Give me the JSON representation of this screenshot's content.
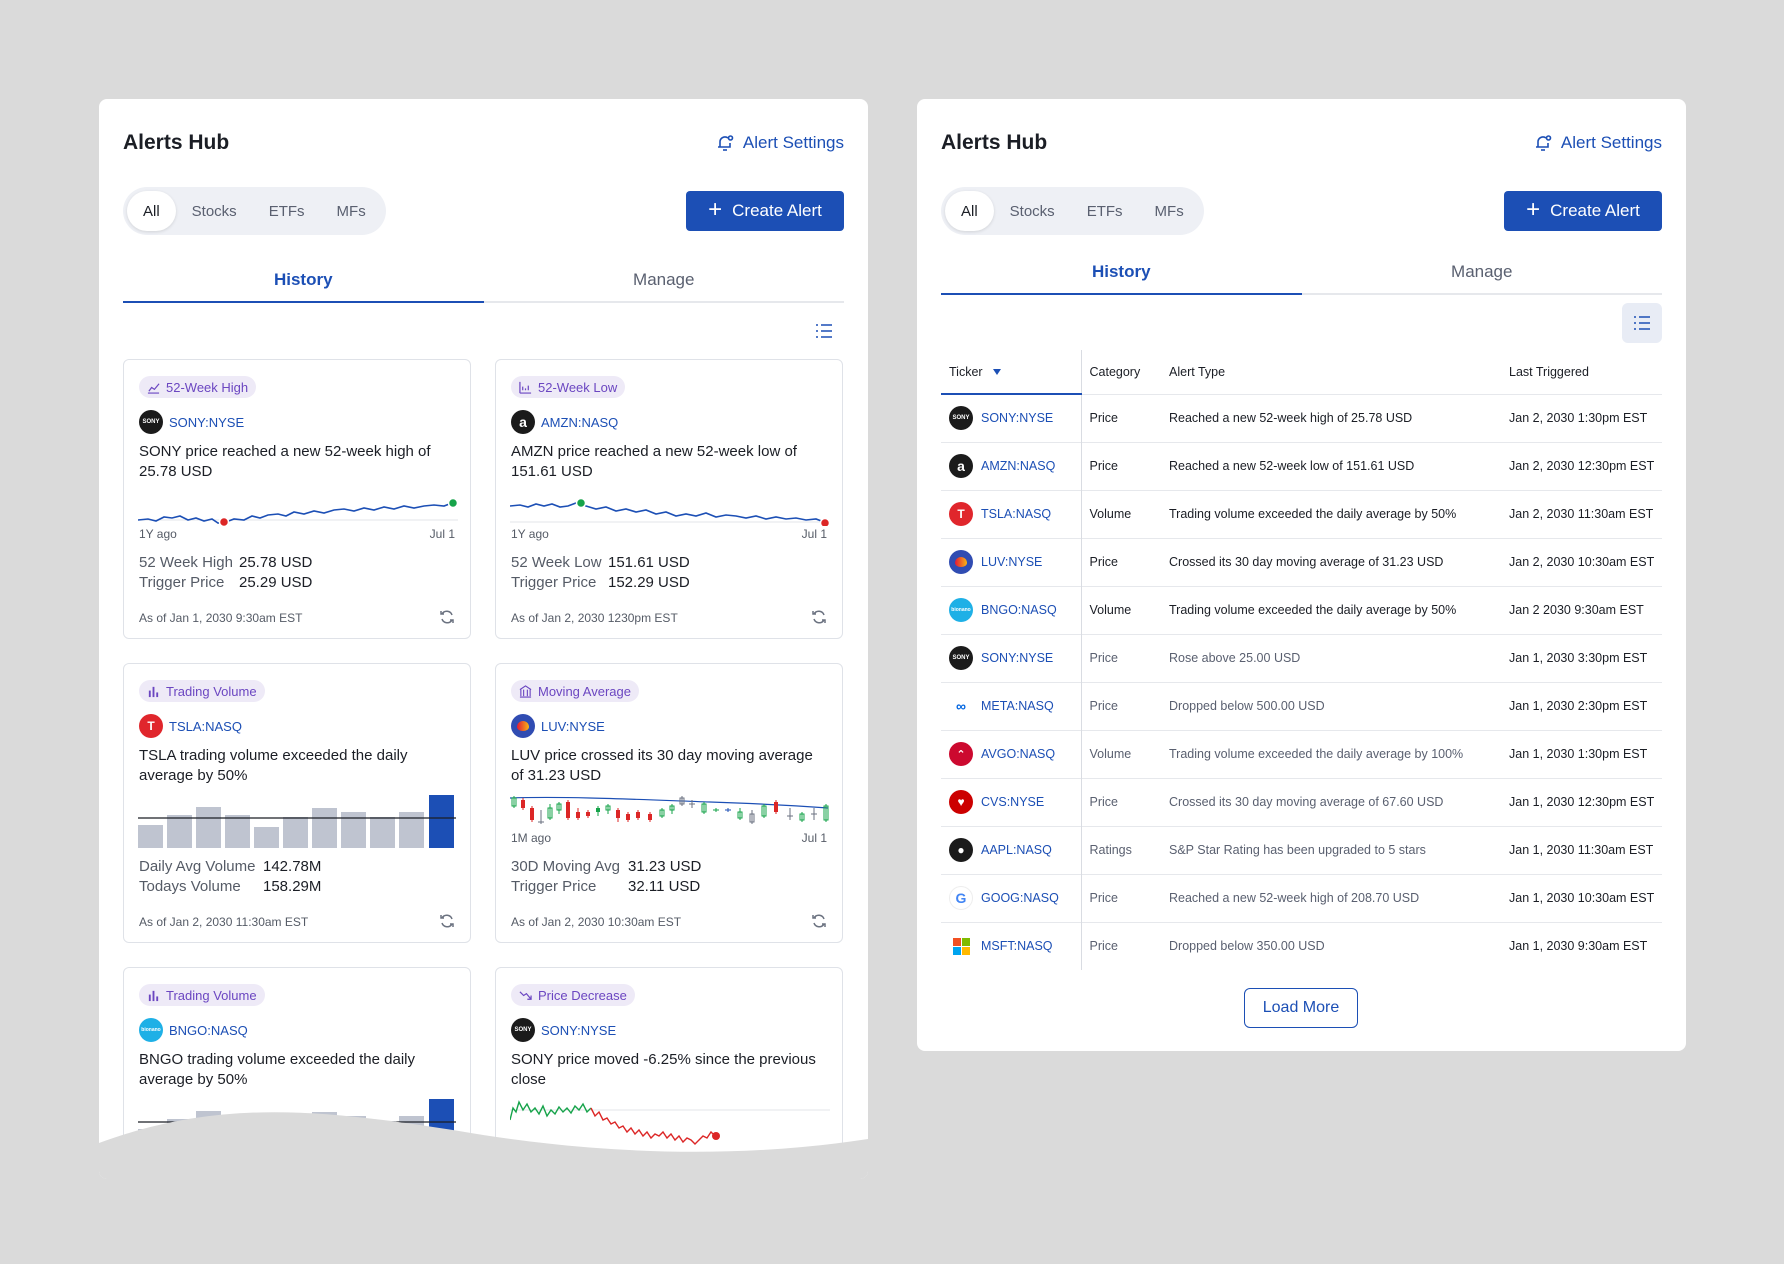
{
  "app": {
    "title": "Alerts Hub",
    "settings_label": "Alert Settings",
    "create_label": "Create Alert",
    "filters": [
      "All",
      "Stocks",
      "ETFs",
      "MFs"
    ],
    "tabs": [
      "History",
      "Manage"
    ],
    "colors": {
      "primary": "#1c4fb5",
      "badge_bg": "#eeeaf7",
      "badge_text": "#6b46c1",
      "up": "#16a34a",
      "down": "#dc2626"
    }
  },
  "cards": [
    {
      "badge": "52-Week High",
      "badge_icon": "chart-up-icon",
      "ticker": "SONY:NYSE",
      "logo": "sony-logo",
      "message": "SONY price reached a new 52-week high of 25.78 USD",
      "axis_left": "1Y ago",
      "axis_right": "Jul 1",
      "stats": [
        {
          "k": "52 Week High",
          "v": "25.78 USD"
        },
        {
          "k": "Trigger Price",
          "v": "25.29 USD"
        }
      ],
      "as_of": "As of Jan 1, 2030 9:30am EST"
    },
    {
      "badge": "52-Week Low",
      "badge_icon": "chart-down-icon",
      "ticker": "AMZN:NASQ",
      "logo": "amazon-logo",
      "message": "AMZN price reached a new 52-week low of 151.61 USD",
      "axis_left": "1Y ago",
      "axis_right": "Jul 1",
      "stats": [
        {
          "k": "52 Week Low",
          "v": "151.61 USD"
        },
        {
          "k": "Trigger Price",
          "v": "152.29 USD"
        }
      ],
      "as_of": "As of Jan 2, 2030 1230pm EST"
    },
    {
      "badge": "Trading Volume",
      "badge_icon": "bar-chart-icon",
      "ticker": "TSLA:NASQ",
      "logo": "tesla-logo",
      "message": "TSLA trading volume exceeded the daily average by 50%",
      "axis_left": "",
      "axis_right": "",
      "stats": [
        {
          "k": "Daily Avg Volume",
          "v": "142.78M"
        },
        {
          "k": "Todays Volume",
          "v": "158.29M"
        }
      ],
      "as_of": "As of Jan 2, 2030 11:30am EST"
    },
    {
      "badge": "Moving Average",
      "badge_icon": "bank-icon",
      "ticker": "LUV:NYSE",
      "logo": "southwest-logo",
      "message": "LUV price crossed its 30 day moving average of 31.23 USD",
      "axis_left": "1M ago",
      "axis_right": "Jul 1",
      "stats": [
        {
          "k": "30D Moving Avg",
          "v": "31.23 USD"
        },
        {
          "k": "Trigger Price",
          "v": "32.11 USD"
        }
      ],
      "as_of": "As of Jan 2, 2030 10:30am EST"
    },
    {
      "badge": "Trading Volume",
      "badge_icon": "bar-chart-icon",
      "ticker": "BNGO:NASQ",
      "logo": "bionano-logo",
      "message": "BNGO trading volume exceeded the daily average by 50%"
    },
    {
      "badge": "Price Decrease",
      "badge_icon": "trend-down-icon",
      "ticker": "SONY:NYSE",
      "logo": "sony-logo",
      "message": "SONY price moved -6.25% since the previous close"
    }
  ],
  "table": {
    "headers": [
      "Ticker",
      "Category",
      "Alert Type",
      "Last Triggered"
    ],
    "rows": [
      {
        "ticker": "SONY:NYSE",
        "logo": "sony-logo",
        "category": "Price",
        "alert_type": "Reached a new 52-week high of 25.78 USD",
        "last": "Jan 2, 2030 1:30pm EST",
        "unread": true
      },
      {
        "ticker": "AMZN:NASQ",
        "logo": "amazon-logo",
        "category": "Price",
        "alert_type": "Reached a new 52-week low of 151.61 USD",
        "last": "Jan 2, 2030 12:30pm EST",
        "unread": true
      },
      {
        "ticker": "TSLA:NASQ",
        "logo": "tesla-logo",
        "category": "Volume",
        "alert_type": "Trading volume exceeded the daily average by 50%",
        "last": "Jan 2, 2030 11:30am EST",
        "unread": true
      },
      {
        "ticker": "LUV:NYSE",
        "logo": "southwest-logo",
        "category": "Price",
        "alert_type": "Crossed its 30 day moving average of 31.23 USD",
        "last": "Jan 2, 2030 10:30am EST",
        "unread": true
      },
      {
        "ticker": "BNGO:NASQ",
        "logo": "bionano-logo",
        "category": "Volume",
        "alert_type": "Trading volume exceeded the daily average by 50%",
        "last": "Jan 2 2030 9:30am EST",
        "unread": true
      },
      {
        "ticker": "SONY:NYSE",
        "logo": "sony-logo",
        "category": "Price",
        "alert_type": "Rose above 25.00 USD",
        "last": "Jan 1, 2030 3:30pm EST",
        "unread": false
      },
      {
        "ticker": "META:NASQ",
        "logo": "meta-logo",
        "category": "Price",
        "alert_type": "Dropped below 500.00 USD",
        "last": "Jan 1, 2030 2:30pm EST",
        "unread": false
      },
      {
        "ticker": "AVGO:NASQ",
        "logo": "broadcom-logo",
        "category": "Volume",
        "alert_type": "Trading volume exceeded the daily average by 100%",
        "last": "Jan 1, 2030 1:30pm EST",
        "unread": false
      },
      {
        "ticker": "CVS:NYSE",
        "logo": "cvs-logo",
        "category": "Price",
        "alert_type": "Crossed its 30 day moving average of 67.60 USD",
        "last": "Jan 1, 2030 12:30pm EST",
        "unread": false
      },
      {
        "ticker": "AAPL:NASQ",
        "logo": "apple-logo",
        "category": "Ratings",
        "alert_type": "S&P Star Rating has been upgraded to 5 stars",
        "last": "Jan 1, 2030 11:30am EST",
        "unread": false
      },
      {
        "ticker": "GOOG:NASQ",
        "logo": "google-logo",
        "category": "Price",
        "alert_type": "Reached a new 52-week high of 208.70 USD",
        "last": "Jan 1, 2030 10:30am EST",
        "unread": false
      },
      {
        "ticker": "MSFT:NASQ",
        "logo": "microsoft-logo",
        "category": "Price",
        "alert_type": "Dropped below 350.00 USD",
        "last": "Jan 1, 2030 9:30am EST",
        "unread": false
      }
    ],
    "load_more": "Load More"
  }
}
